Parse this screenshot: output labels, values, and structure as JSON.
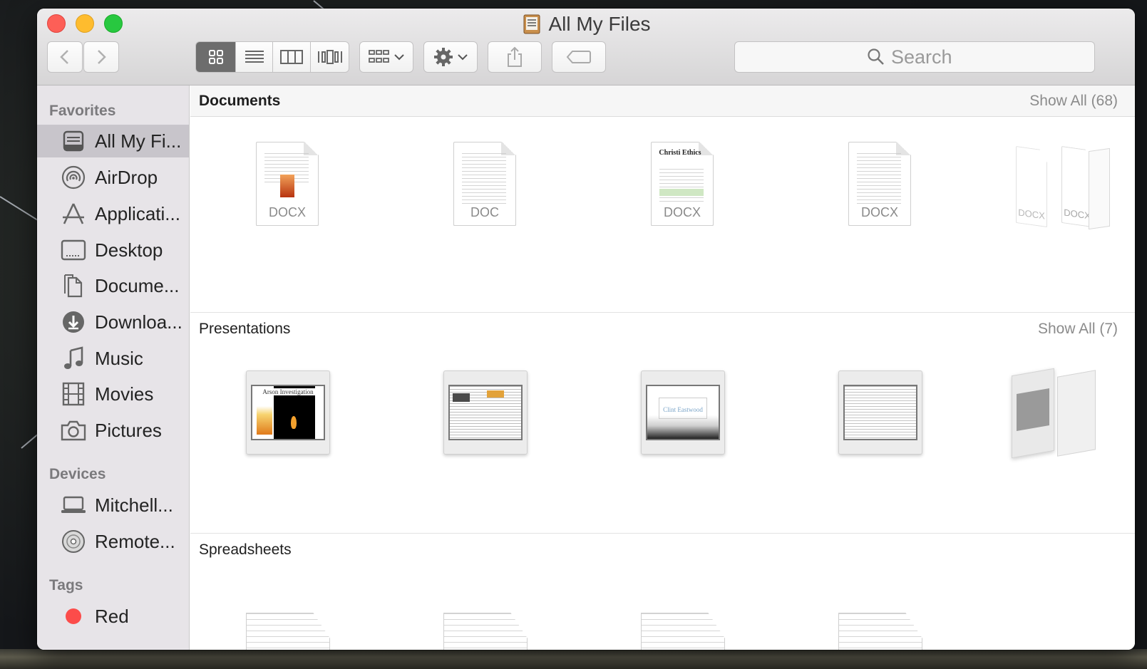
{
  "window": {
    "title": "All My Files"
  },
  "toolbar": {
    "back_label": "Back",
    "forward_label": "Forward",
    "views": [
      "icon",
      "list",
      "columns",
      "cover-flow"
    ],
    "active_view": "icon",
    "search_placeholder": "Search"
  },
  "sidebar": {
    "favorites_heading": "Favorites",
    "favorites": [
      {
        "label": "All My Fi...",
        "icon": "all-my-files-icon",
        "selected": true
      },
      {
        "label": "AirDrop",
        "icon": "airdrop-icon"
      },
      {
        "label": "Applicati...",
        "icon": "applications-icon"
      },
      {
        "label": "Desktop",
        "icon": "desktop-icon"
      },
      {
        "label": "Docume...",
        "icon": "documents-icon"
      },
      {
        "label": "Downloa...",
        "icon": "downloads-icon"
      },
      {
        "label": "Music",
        "icon": "music-icon"
      },
      {
        "label": "Movies",
        "icon": "movies-icon"
      },
      {
        "label": "Pictures",
        "icon": "pictures-icon"
      }
    ],
    "devices_heading": "Devices",
    "devices": [
      {
        "label": "Mitchell...",
        "icon": "laptop-icon"
      },
      {
        "label": "Remote...",
        "icon": "remote-disc-icon"
      }
    ],
    "tags_heading": "Tags",
    "tags": [
      {
        "label": "Red",
        "color": "#fc4c4a"
      }
    ]
  },
  "sections": {
    "documents": {
      "title": "Documents",
      "show_all": "Show All (68)",
      "items": [
        {
          "ext": "DOCX"
        },
        {
          "ext": "DOC"
        },
        {
          "ext": "DOCX",
          "preview_title": "Christi Ethics"
        },
        {
          "ext": "DOCX"
        }
      ],
      "stack_exts": [
        "DOCX",
        "DOCX"
      ]
    },
    "presentations": {
      "title": "Presentations",
      "show_all": "Show All (7)",
      "items": [
        {
          "caption": "Arson Investigation"
        },
        {
          "caption": ""
        },
        {
          "caption": "Clint Eastwood"
        },
        {
          "caption": ""
        }
      ]
    },
    "spreadsheets": {
      "title": "Spreadsheets"
    }
  }
}
